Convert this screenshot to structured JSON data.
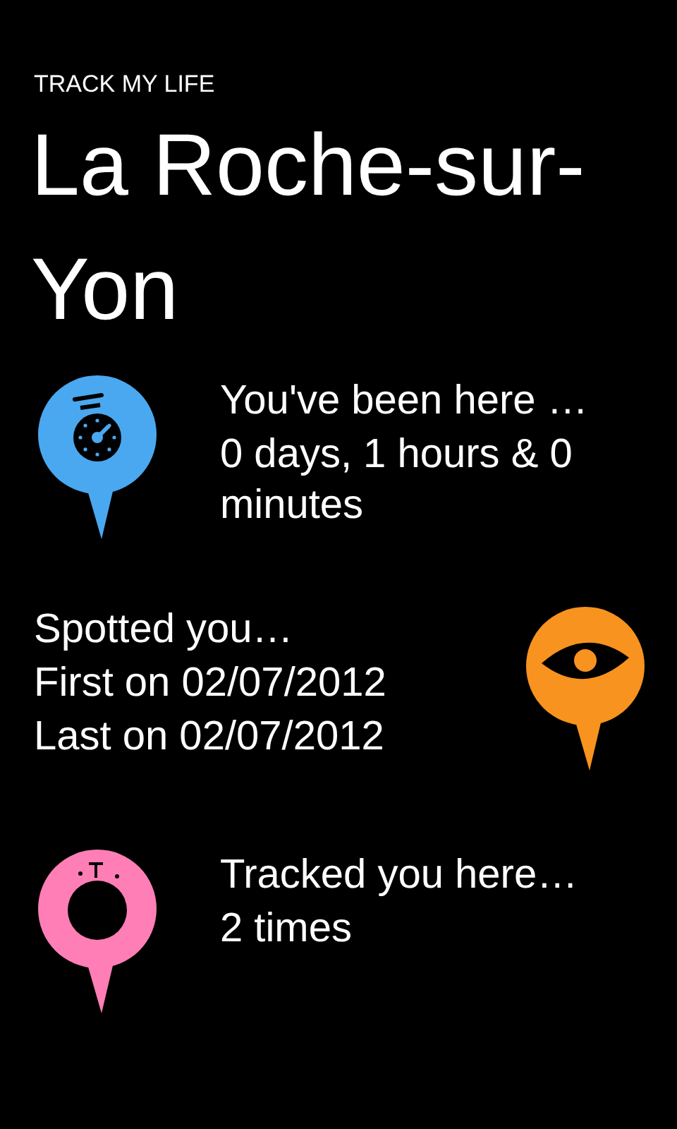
{
  "app_title": "TRACK MY LIFE",
  "place": "La Roche-sur-Yon",
  "sections": [
    {
      "kind": "stopwatch",
      "icon_right": false,
      "color": "#4aa8f0",
      "lines": [
        "You've been here …",
        "0 days, 1 hours & 0 minutes"
      ]
    },
    {
      "kind": "eye",
      "icon_right": true,
      "color": "#f7931e",
      "lines": [
        "Spotted you…",
        "First on 02/07/2012",
        "Last on 02/07/2012"
      ]
    },
    {
      "kind": "ring",
      "icon_right": false,
      "color": "#ff7eb6",
      "lines": [
        "Tracked you here…",
        "2 times"
      ]
    }
  ]
}
